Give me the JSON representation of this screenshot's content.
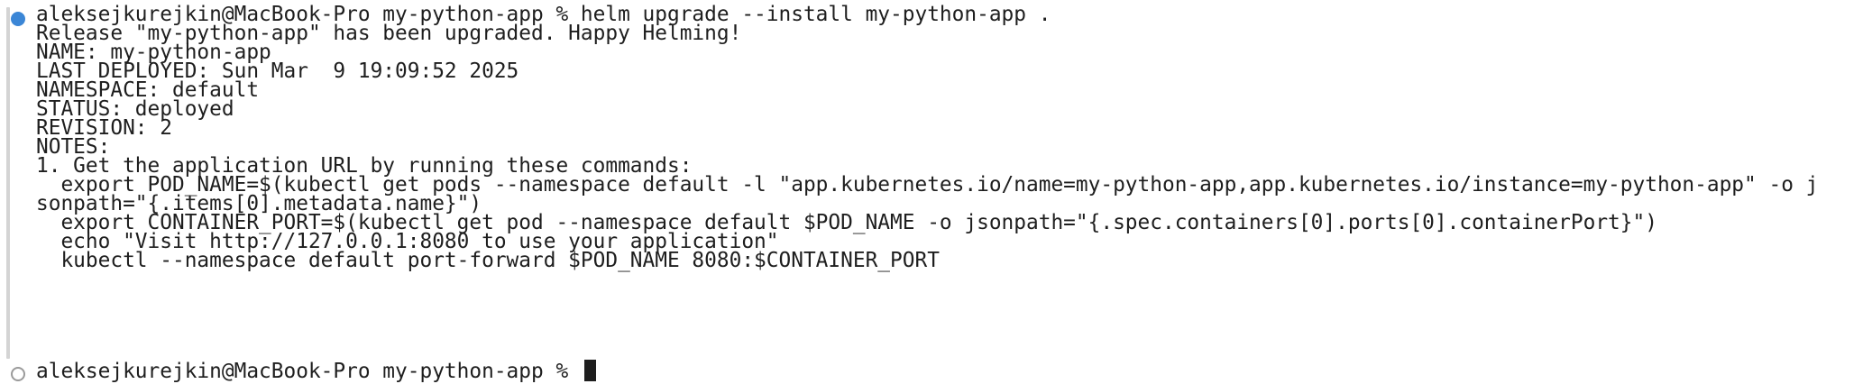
{
  "terminal": {
    "command_line": "aleksejkurejkin@MacBook-Pro my-python-app % helm upgrade --install my-python-app .",
    "output": [
      "Release \"my-python-app\" has been upgraded. Happy Helming!",
      "NAME: my-python-app",
      "LAST DEPLOYED: Sun Mar  9 19:09:52 2025",
      "NAMESPACE: default",
      "STATUS: deployed",
      "REVISION: 2",
      "NOTES:",
      "1. Get the application URL by running these commands:",
      "  export POD_NAME=$(kubectl get pods --namespace default -l \"app.kubernetes.io/name=my-python-app,app.kubernetes.io/instance=my-python-app\" -o j",
      "sonpath=\"{.items[0].metadata.name}\")",
      "  export CONTAINER_PORT=$(kubectl get pod --namespace default $POD_NAME -o jsonpath=\"{.spec.containers[0].ports[0].containerPort}\")",
      "  echo \"Visit http://127.0.0.1:8080 to use your application\"",
      "  kubectl --namespace default port-forward $POD_NAME 8080:$CONTAINER_PORT"
    ],
    "prompt_line": "aleksejkurejkin@MacBook-Pro my-python-app % "
  },
  "colors": {
    "background": "#ffffff",
    "text": "#1e1e1e",
    "mark_filled": "#3b86d6",
    "mark_hollow": "#9a9a9a",
    "block_bar": "#d4d4d4"
  }
}
